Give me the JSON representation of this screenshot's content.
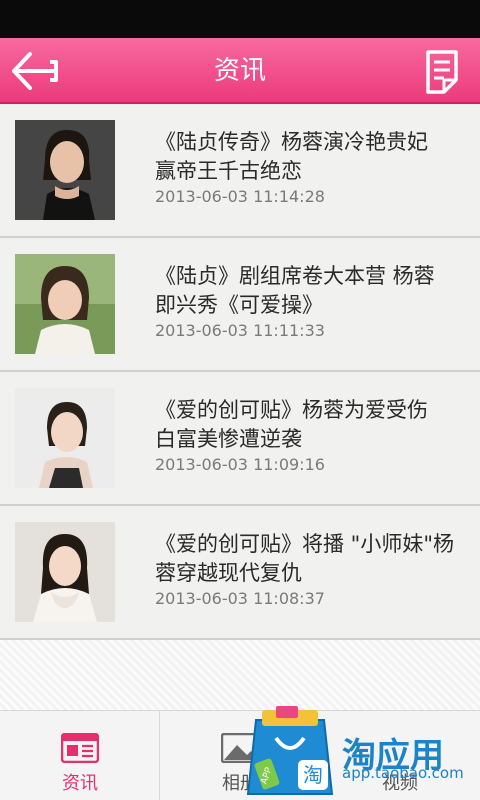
{
  "header": {
    "title": "资讯"
  },
  "news": [
    {
      "title": "《陆贞传奇》杨蓉演冷艳贵妃 赢帝王千古绝恋",
      "time": "2013-06-03 11:14:28"
    },
    {
      "title": "《陆贞》剧组席卷大本营 杨蓉即兴秀《可爱操》",
      "time": "2013-06-03 11:11:33"
    },
    {
      "title": "《爱的创可贴》杨蓉为爱受伤 白富美惨遭逆袭",
      "time": "2013-06-03 11:09:16"
    },
    {
      "title": "《爱的创可贴》将播 \"小师妹\"杨蓉穿越现代复仇",
      "time": "2013-06-03 11:08:37"
    }
  ],
  "tabs": [
    {
      "label": "资讯",
      "icon": "news-icon",
      "active": true
    },
    {
      "label": "相册",
      "icon": "photo-icon",
      "active": false
    },
    {
      "label": "视频",
      "icon": "video-icon",
      "active": false
    }
  ],
  "promo": {
    "brand": "淘应用",
    "url": "app.taobao.com",
    "badge": "APP",
    "bag_char": "淘"
  },
  "colors": {
    "accent": "#ec3a7b",
    "header_dark": "#c9245f",
    "promo_blue": "#1d83c7"
  }
}
